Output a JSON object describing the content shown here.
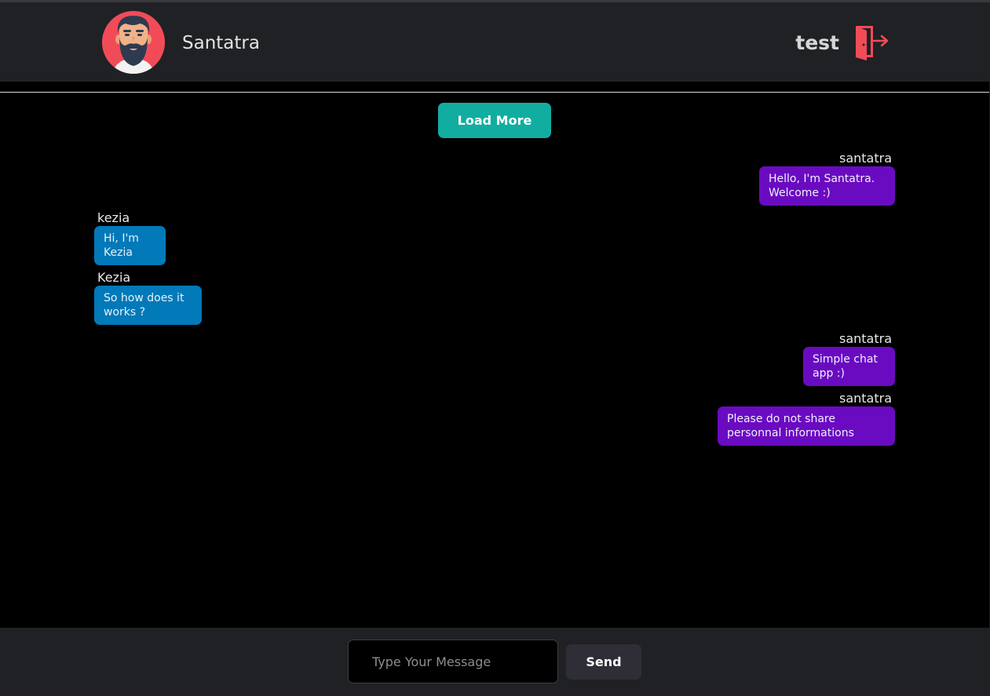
{
  "header": {
    "name": "Santatra",
    "current_user": "test",
    "avatar_icon": "bearded-man-avatar-icon",
    "logout_icon": "door-exit-icon"
  },
  "chat": {
    "load_more_label": "Load More",
    "messages": [
      {
        "sender": "santatra",
        "text": "Hello, I'm Santatra. Welcome :)",
        "side": "right"
      },
      {
        "sender": "kezia",
        "text": "Hi, I'm Kezia",
        "side": "left"
      },
      {
        "sender": "Kezia",
        "text": "So how does it works ?",
        "side": "left"
      },
      {
        "sender": "santatra",
        "text": "Simple chat app :)",
        "side": "right"
      },
      {
        "sender": "santatra",
        "text": "Please do not share personnal informations",
        "side": "right"
      }
    ]
  },
  "composer": {
    "placeholder": "Type Your Message",
    "value": "",
    "send_label": "Send"
  },
  "colors": {
    "header_bg": "#202124",
    "background": "#000000",
    "accent_teal": "#12ada1",
    "own_bubble": "#6a0bc2",
    "other_bubble": "#0279b9",
    "logout_red": "#f24b58"
  }
}
